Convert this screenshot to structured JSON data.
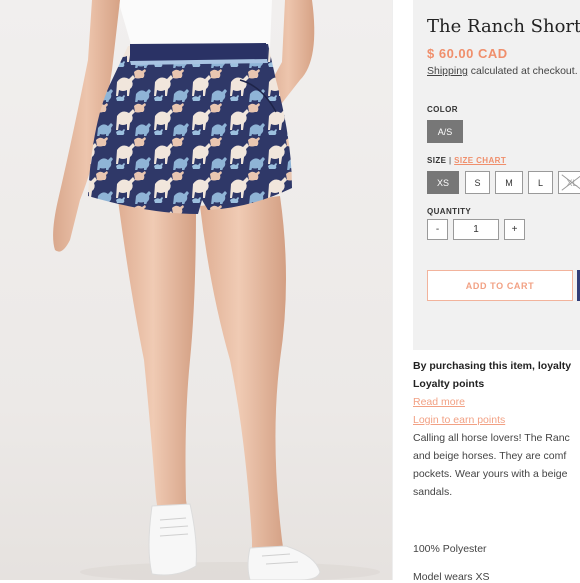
{
  "product": {
    "title": "The Ranch Shorts",
    "price": "$ 60.00 CAD",
    "shipping_link": "Shipping",
    "shipping_text": " calculated at checkout."
  },
  "color": {
    "label": "COLOR",
    "selected": "A/S"
  },
  "size": {
    "label": "SIZE",
    "separator": "|",
    "chart_link": "SIZE CHART",
    "options": [
      "XS",
      "S",
      "M",
      "L",
      "XL"
    ],
    "selected": "XS",
    "unavailable": "XL"
  },
  "quantity": {
    "label": "QUANTITY",
    "minus": "-",
    "value": "1",
    "plus": "+"
  },
  "add_to_cart": "ADD TO CART",
  "loyalty": {
    "line1": "By purchasing this item, loyalty",
    "line2": "Loyalty points",
    "read_more": "Read more",
    "login": "Login to earn points"
  },
  "description": {
    "line1": "Calling all horse lovers! The Ranc",
    "line2": "and beige horses. They are comf",
    "line3": "pockets. Wear yours with a beige",
    "line4": "sandals.",
    "material": "100% Polyester",
    "model": "Model wears XS"
  },
  "colors": {
    "accent": "#f08f6c",
    "navy": "#303d78",
    "selected_option": "#777777"
  }
}
